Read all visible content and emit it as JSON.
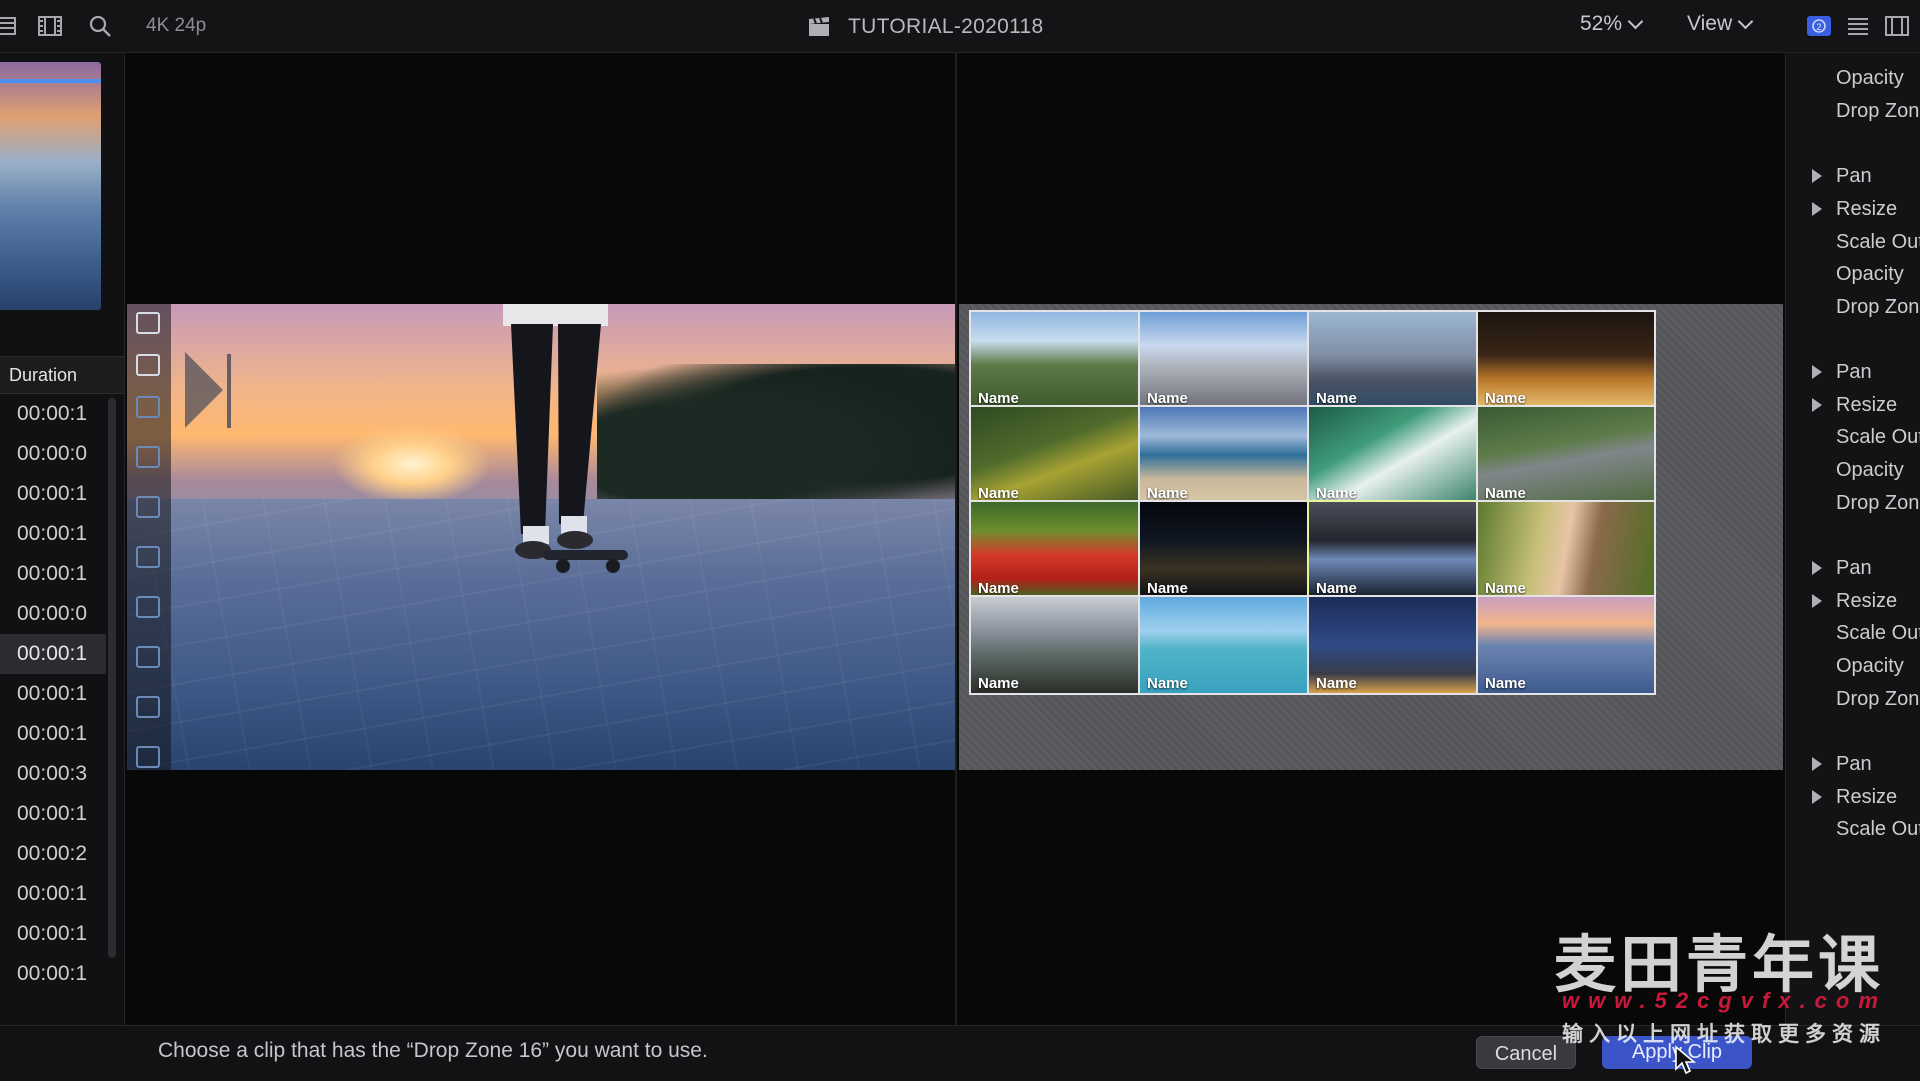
{
  "toolbar": {
    "format": "4K 24p",
    "project_title": "TUTORIAL-2020118",
    "zoom_label": "52%",
    "view_label": "View",
    "icons": [
      "browser-icon",
      "filmstrip-icon",
      "search-icon",
      "clapper-icon",
      "inspector-icon",
      "list-icon",
      "film-icon"
    ]
  },
  "sidebar": {
    "duration_header": "Duration",
    "durations": [
      "00:00:1",
      "00:00:0",
      "00:00:1",
      "00:00:1",
      "00:00:1",
      "00:00:0",
      "00:00:1",
      "00:00:1",
      "00:00:1",
      "00:00:3",
      "00:00:1",
      "00:00:2",
      "00:00:1",
      "00:00:1",
      "00:00:1"
    ],
    "selected_index": 6
  },
  "drop_zones": {
    "tile_label": "Name",
    "tiles": [
      {
        "label": "Name",
        "scene": "vineyard-bottle"
      },
      {
        "label": "Name",
        "scene": "city-skyline-day"
      },
      {
        "label": "Name",
        "scene": "harbor-skyline"
      },
      {
        "label": "Name",
        "scene": "london-night"
      },
      {
        "label": "Name",
        "scene": "yellow-flowers"
      },
      {
        "label": "Name",
        "scene": "beach-coast"
      },
      {
        "label": "Name",
        "scene": "ocean-waves"
      },
      {
        "label": "Name",
        "scene": "airstrip-plane"
      },
      {
        "label": "Name",
        "scene": "red-tulips"
      },
      {
        "label": "Name",
        "scene": "city-lights-night"
      },
      {
        "label": "Name",
        "scene": "harbor-night",
        "active": true
      },
      {
        "label": "Name",
        "scene": "woman-portrait"
      },
      {
        "label": "Name",
        "scene": "mountain-valley"
      },
      {
        "label": "Name",
        "scene": "tropical-sea"
      },
      {
        "label": "Name",
        "scene": "eiffel-tower-night"
      },
      {
        "label": "Name",
        "scene": "skateboarder"
      }
    ]
  },
  "inspector": {
    "rows": [
      {
        "label": "Opacity",
        "disclosure": false
      },
      {
        "label": "Drop Zon",
        "disclosure": false
      },
      {
        "label": "Pan",
        "disclosure": true
      },
      {
        "label": "Resize",
        "disclosure": true
      },
      {
        "label": "Scale Out",
        "disclosure": false
      },
      {
        "label": "Opacity",
        "disclosure": false
      },
      {
        "label": "Drop Zon",
        "disclosure": false
      },
      {
        "label": "Pan",
        "disclosure": true
      },
      {
        "label": "Resize",
        "disclosure": true
      },
      {
        "label": "Scale Out",
        "disclosure": false
      },
      {
        "label": "Opacity",
        "disclosure": false
      },
      {
        "label": "Drop Zon",
        "disclosure": false
      },
      {
        "label": "Pan",
        "disclosure": true
      },
      {
        "label": "Resize",
        "disclosure": true
      },
      {
        "label": "Scale Out",
        "disclosure": false
      },
      {
        "label": "Opacity",
        "disclosure": false
      },
      {
        "label": "Drop Zon",
        "disclosure": false
      },
      {
        "label": "Pan",
        "disclosure": true
      },
      {
        "label": "Resize",
        "disclosure": true
      },
      {
        "label": "Scale Out",
        "disclosure": false
      }
    ]
  },
  "footer": {
    "prompt": "Choose a clip that has the “Drop Zone 16” you want to use.",
    "cancel_label": "Cancel",
    "apply_label": "Apply Clip"
  },
  "watermark": {
    "main": "麦田青年课",
    "url": "www.52cgvfx.com",
    "sub": "输入以上网址获取更多资源"
  },
  "colors": {
    "accent": "#3b55c8",
    "active_tile_border": "#e8f39a",
    "watermark_url": "#c9183a"
  }
}
